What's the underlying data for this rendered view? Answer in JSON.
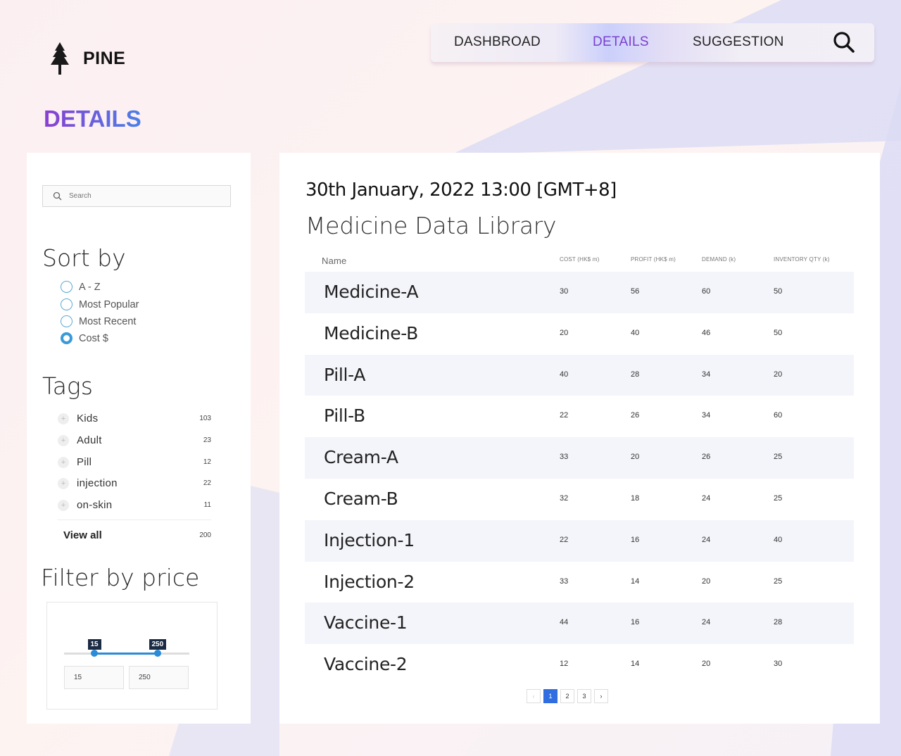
{
  "app": {
    "logo_text": "PINE",
    "page_title": "DETAILS"
  },
  "nav": {
    "items": [
      {
        "label": "DASHBROAD",
        "active": false
      },
      {
        "label": "DETAILS",
        "active": true
      },
      {
        "label": "SUGGESTION",
        "active": false
      }
    ],
    "search_icon": "search-icon",
    "active_color": "#7b3fd0"
  },
  "sidebar": {
    "search": {
      "placeholder": "Search",
      "value": ""
    },
    "sort": {
      "title": "Sort by",
      "options": [
        {
          "label": "A - Z",
          "checked": false
        },
        {
          "label": "Most Popular",
          "checked": false
        },
        {
          "label": "Most Recent",
          "checked": false
        },
        {
          "label": "Cost $",
          "checked": true
        }
      ]
    },
    "tags": {
      "title": "Tags",
      "items": [
        {
          "label": "Kids",
          "count": "103"
        },
        {
          "label": "Adult",
          "count": "23"
        },
        {
          "label": "Pill",
          "count": "12"
        },
        {
          "label": "injection",
          "count": "22"
        },
        {
          "label": "on-skin",
          "count": "11"
        }
      ],
      "view_all": {
        "label": "View all",
        "count": "200"
      }
    },
    "price": {
      "title": "Filter by price",
      "min": 15,
      "max": 250,
      "selected_min": 15,
      "selected_max": 250,
      "min_label": "15",
      "max_label": "250",
      "min_value": "15",
      "max_value": "250"
    }
  },
  "main": {
    "datetime": "30th January, 2022  13:00 [GMT+8]",
    "heading": "Medicine Data Library",
    "columns": {
      "name": "Name",
      "cost": "COST (HK$ m)",
      "profit": "PROFIT (HK$ m)",
      "demand": "DEMAND (k)",
      "inventory": "INVENTORY QTY (k)"
    },
    "rows": [
      {
        "name": "Medicine-A",
        "cost": "30",
        "profit": "56",
        "demand": "60",
        "inventory": "50"
      },
      {
        "name": "Medicine-B",
        "cost": "20",
        "profit": "40",
        "demand": "46",
        "inventory": "50"
      },
      {
        "name": "Pill-A",
        "cost": "40",
        "profit": "28",
        "demand": "34",
        "inventory": "20"
      },
      {
        "name": "Pill-B",
        "cost": "22",
        "profit": "26",
        "demand": "34",
        "inventory": "60"
      },
      {
        "name": "Cream-A",
        "cost": "33",
        "profit": "20",
        "demand": "26",
        "inventory": "25"
      },
      {
        "name": "Cream-B",
        "cost": "32",
        "profit": "18",
        "demand": "24",
        "inventory": "25"
      },
      {
        "name": "Injection-1",
        "cost": "22",
        "profit": "16",
        "demand": "24",
        "inventory": "40"
      },
      {
        "name": "Injection-2",
        "cost": "33",
        "profit": "14",
        "demand": "20",
        "inventory": "25"
      },
      {
        "name": "Vaccine-1",
        "cost": "44",
        "profit": "16",
        "demand": "24",
        "inventory": "28"
      },
      {
        "name": "Vaccine-2",
        "cost": "12",
        "profit": "14",
        "demand": "20",
        "inventory": "30"
      }
    ],
    "pagination": {
      "prev": "‹",
      "pages": [
        "1",
        "2",
        "3"
      ],
      "current": "1",
      "next": "›"
    }
  }
}
